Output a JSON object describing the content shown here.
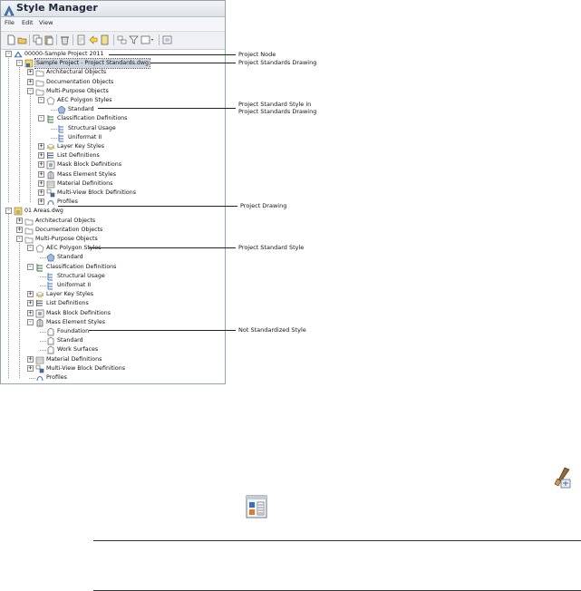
{
  "window": {
    "title": "Style Manager",
    "menu": [
      "File",
      "Edit",
      "View"
    ]
  },
  "tree": [
    {
      "label": "00000-Sample Project 2011",
      "icon": "project-icon",
      "expander": "-",
      "level": 0
    },
    {
      "label": "Sample Project - Project Standards.dwg",
      "icon": "standards-drawing-icon",
      "expander": "-",
      "level": 1,
      "selected": true
    },
    {
      "label": "Architectural Objects",
      "icon": "folder-icon",
      "expander": "+",
      "level": 2
    },
    {
      "label": "Documentation Objects",
      "icon": "folder-icon",
      "expander": "+",
      "level": 2
    },
    {
      "label": "Multi-Purpose Objects",
      "icon": "folder-icon",
      "expander": "-",
      "level": 2
    },
    {
      "label": "AEC Polygon Styles",
      "icon": "polygon-icon",
      "expander": "-",
      "level": 3
    },
    {
      "label": "Standard",
      "icon": "polygon-style-icon",
      "expander": "",
      "level": 4
    },
    {
      "label": "Classification Definitions",
      "icon": "classification-icon",
      "expander": "-",
      "level": 3
    },
    {
      "label": "Structural Usage",
      "icon": "classification-item-icon",
      "expander": "",
      "level": 4
    },
    {
      "label": "Uniformat II",
      "icon": "classification-item-icon",
      "expander": "",
      "level": 4
    },
    {
      "label": "Layer Key Styles",
      "icon": "layer-key-icon",
      "expander": "+",
      "level": 3
    },
    {
      "label": "List Definitions",
      "icon": "list-icon",
      "expander": "+",
      "level": 3
    },
    {
      "label": "Mask Block Definitions",
      "icon": "mask-block-icon",
      "expander": "+",
      "level": 3
    },
    {
      "label": "Mass Element Styles",
      "icon": "mass-element-icon",
      "expander": "+",
      "level": 3
    },
    {
      "label": "Material Definitions",
      "icon": "material-icon",
      "expander": "+",
      "level": 3
    },
    {
      "label": "Multi-View Block Definitions",
      "icon": "multiview-block-icon",
      "expander": "+",
      "level": 3
    },
    {
      "label": "Profiles",
      "icon": "profile-icon",
      "expander": "+",
      "level": 3
    },
    {
      "label": "01 Areas.dwg",
      "icon": "drawing-icon",
      "expander": "-",
      "level": 0
    },
    {
      "label": "Architectural Objects",
      "icon": "folder-icon",
      "expander": "+",
      "level": 1
    },
    {
      "label": "Documentation Objects",
      "icon": "folder-icon",
      "expander": "+",
      "level": 1
    },
    {
      "label": "Multi-Purpose Objects",
      "icon": "folder-icon",
      "expander": "-",
      "level": 1
    },
    {
      "label": "AEC Polygon Styles",
      "icon": "polygon-icon",
      "expander": "-",
      "level": 2
    },
    {
      "label": "Standard",
      "icon": "polygon-style-icon",
      "expander": "",
      "level": 3
    },
    {
      "label": "Classification Definitions",
      "icon": "classification-icon",
      "expander": "-",
      "level": 2
    },
    {
      "label": "Structural Usage",
      "icon": "classification-item-icon",
      "expander": "",
      "level": 3
    },
    {
      "label": "Uniformat II",
      "icon": "classification-item-icon",
      "expander": "",
      "level": 3
    },
    {
      "label": "Layer Key Styles",
      "icon": "layer-key-icon",
      "expander": "+",
      "level": 2
    },
    {
      "label": "List Definitions",
      "icon": "list-icon",
      "expander": "+",
      "level": 2
    },
    {
      "label": "Mask Block Definitions",
      "icon": "mask-block-icon",
      "expander": "+",
      "level": 2
    },
    {
      "label": "Mass Element Styles",
      "icon": "mass-element-icon",
      "expander": "-",
      "level": 2
    },
    {
      "label": "Foundation",
      "icon": "mass-style-icon",
      "expander": "",
      "level": 3
    },
    {
      "label": "Standard",
      "icon": "mass-style-icon",
      "expander": "",
      "level": 3
    },
    {
      "label": "Work Surfaces",
      "icon": "mass-style-icon",
      "expander": "",
      "level": 3
    },
    {
      "label": "Material Definitions",
      "icon": "material-icon",
      "expander": "+",
      "level": 2
    },
    {
      "label": "Multi-View Block Definitions",
      "icon": "multiview-block-icon",
      "expander": "+",
      "level": 2
    },
    {
      "label": "Profiles",
      "icon": "profile-icon",
      "expander": "",
      "level": 2
    }
  ],
  "callouts": {
    "project_node": "Project Node",
    "project_standards_drawing": "Project Standards Drawing",
    "project_standard_style_in_line1": "Project Standard Style in",
    "project_standard_style_in_line2": "Project Standards Drawing",
    "project_drawing": "Project Drawing",
    "project_standard_style": "Project Standard Style",
    "not_standardized_style": "Not Standardized Style"
  },
  "icons": {
    "sync_tool": "synchronize-project-icon",
    "style_manager_tool": "style-manager-icon"
  },
  "colors": {
    "selection": "#cfd6e2",
    "folder": "#e8c86a",
    "accent_blue": "#3a6fb5"
  }
}
